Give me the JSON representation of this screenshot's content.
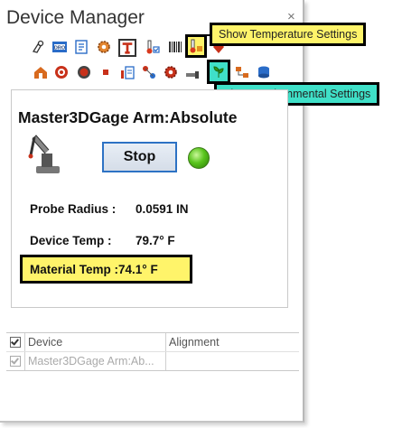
{
  "window": {
    "title": "Device Manager",
    "close_glyph": "×"
  },
  "callouts": {
    "temperature": {
      "text": "Show Temperature Settings",
      "bg": "#fff46a"
    },
    "environmental": {
      "text": "Show Environmental Settings",
      "bg": "#3fe0c8"
    }
  },
  "toolbar": {
    "row1": [
      "probe-icon",
      "dro-icon",
      "report-icon",
      "settings-gear-icon",
      "tripod-icon",
      "thermometer-icon",
      "barcode-icon",
      "temperature-settings-icon",
      "extra-icon"
    ],
    "row2": [
      "home-icon",
      "target-icon",
      "red-circle-icon",
      "point-icon",
      "document-icon",
      "pattern-icon",
      "gear-icon",
      "probe-small-icon",
      "environmental-settings-icon",
      "network-icon",
      "storage-icon"
    ]
  },
  "device": {
    "name": "Master3DGage Arm:Absolute",
    "stop_label": "Stop",
    "status_color": "#3cb314",
    "probe_radius_label": "Probe Radius :",
    "probe_radius_value": "0.0591 IN",
    "device_temp_label": "Device Temp :",
    "device_temp_value": "79.7° F",
    "material_temp_label": "Material Temp :",
    "material_temp_value": "74.1° F"
  },
  "grid": {
    "columns": [
      "Device",
      "Alignment"
    ],
    "rows": [
      {
        "device": "Master3DGage Arm:Ab...",
        "alignment": "",
        "checked": true
      }
    ]
  }
}
